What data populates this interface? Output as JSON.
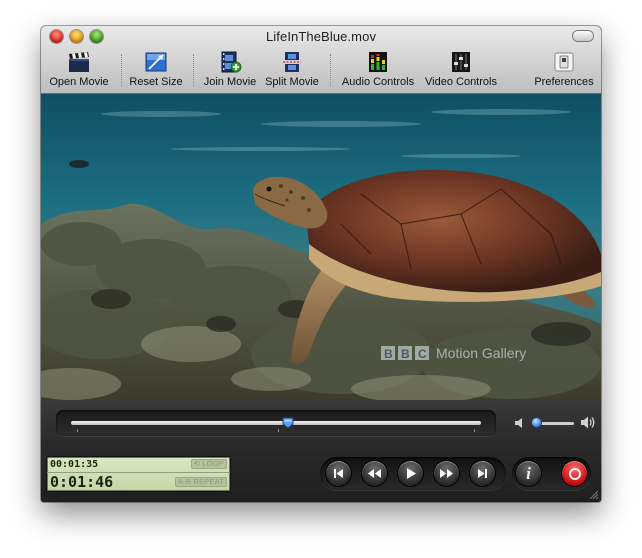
{
  "window": {
    "title": "LifeInTheBlue.mov"
  },
  "toolbar": {
    "items": [
      {
        "label": "Open Movie",
        "icon": "clapperboard-icon"
      },
      {
        "label": "Reset Size",
        "icon": "resize-icon"
      },
      {
        "label": "Join Movie",
        "icon": "join-film-icon"
      },
      {
        "label": "Split Movie",
        "icon": "split-film-icon"
      },
      {
        "label": "Audio Controls",
        "icon": "audio-equalizer-icon"
      },
      {
        "label": "Video Controls",
        "icon": "video-sliders-icon"
      },
      {
        "label": "Preferences",
        "icon": "preferences-switch-icon"
      }
    ]
  },
  "video": {
    "watermark": "BBC Motion Gallery"
  },
  "playback": {
    "position_fraction": 0.53,
    "volume_fraction": 0.1
  },
  "lcd": {
    "current_time": "00:01:35",
    "duration": "0:01:46",
    "loop_label": "LOOP",
    "ab_repeat_label": "A-B REPEAT"
  },
  "colors": {
    "lcd_background": "#cddfb4",
    "record": "#d11a1a",
    "seek_thumb": "#4a90e2"
  }
}
